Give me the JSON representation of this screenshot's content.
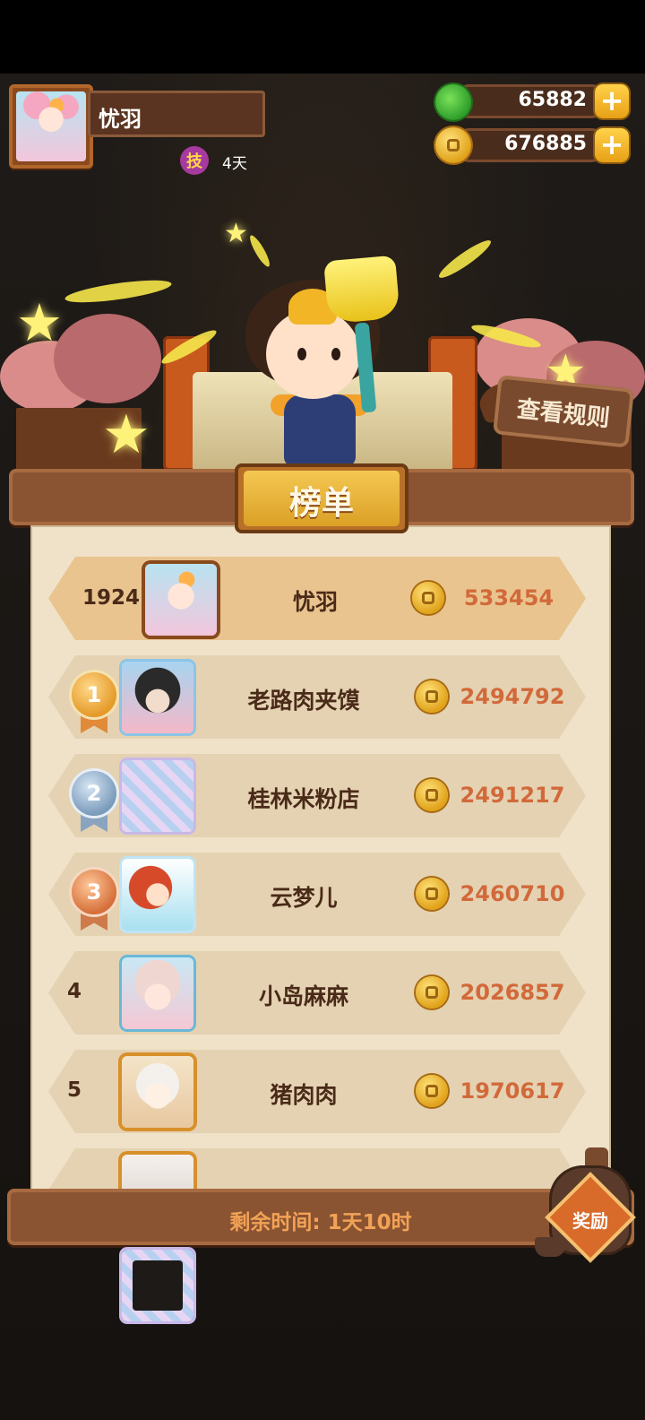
{
  "player": {
    "name": "忧羽",
    "skill_badge": "技",
    "skill_days": "4天"
  },
  "currencies": [
    {
      "name": "apple",
      "icon": "apple-icon",
      "value": "65882",
      "plus": "+"
    },
    {
      "name": "coin",
      "icon": "coin-icon",
      "value": "676885",
      "plus": "+"
    }
  ],
  "scene": {
    "rules_button": "查看规则"
  },
  "board": {
    "title": "榜单",
    "self_row": {
      "rank": "1924",
      "name": "忧羽",
      "score": "533454"
    },
    "rows": [
      {
        "rank": "1",
        "medal": "gold",
        "name": "老路肉夹馍",
        "score": "2494792"
      },
      {
        "rank": "2",
        "medal": "silver",
        "name": "桂林米粉店",
        "score": "2491217"
      },
      {
        "rank": "3",
        "medal": "bronze",
        "name": "云梦儿",
        "score": "2460710"
      },
      {
        "rank": "4",
        "medal": "",
        "name": "小岛麻麻",
        "score": "2026857"
      },
      {
        "rank": "5",
        "medal": "",
        "name": "猪肉肉",
        "score": "1970617"
      }
    ],
    "remaining_time": "剩余时间: 1天10时",
    "reward_label": "奖励"
  },
  "colors": {
    "score": "#d2693a",
    "wood": "#8a5432",
    "paper": "#efe2c8"
  }
}
